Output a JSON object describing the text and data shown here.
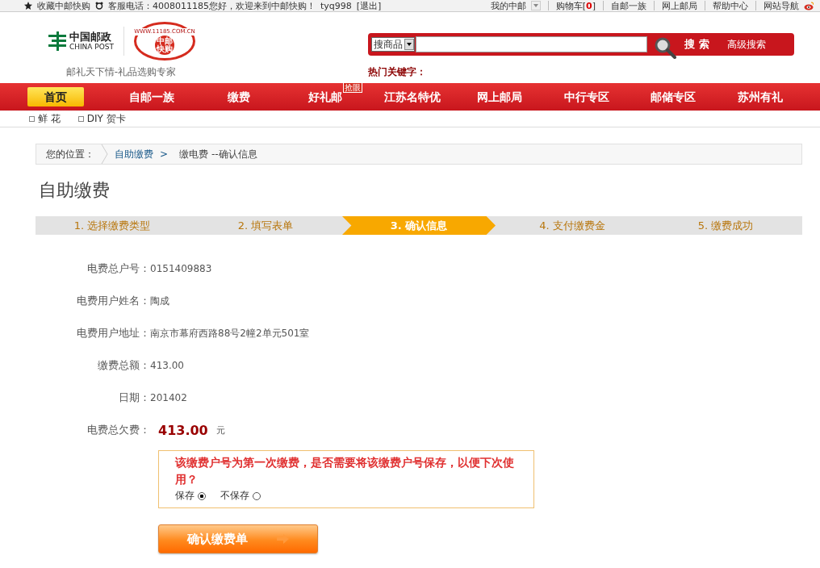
{
  "top_bar": {
    "favorite": "收藏中邮快购",
    "hotline": "客服电话：4008011185您好，欢迎来到中邮快购！",
    "user": "tyq998",
    "logout": "[退出]",
    "links": [
      {
        "label": "我的中邮",
        "kind": "dropdown"
      },
      {
        "label": "购物车[",
        "count": "0",
        "close": "]",
        "kind": "cart"
      },
      {
        "label": "自邮一族",
        "kind": "link"
      },
      {
        "label": "网上邮局",
        "kind": "link"
      },
      {
        "label": "帮助中心",
        "kind": "link"
      },
      {
        "label": "网站导航",
        "kind": "link"
      }
    ]
  },
  "header": {
    "logo_cn": "中国邮政",
    "logo_en": "CHINA POST",
    "badge_top": "WWW.11185.COM.CN",
    "badge_center": "中邮快购",
    "slogan": "邮礼天下情-礼品选购专家",
    "search_scope": "搜商品",
    "search_button": "搜 索",
    "advanced": "高级搜索",
    "hot_keywords": "热门关键字："
  },
  "nav": [
    {
      "label": "首页",
      "selected": true
    },
    {
      "label": "自邮一族",
      "selected": false
    },
    {
      "label": "缴费",
      "selected": false
    },
    {
      "label": "好礼邮",
      "selected": false,
      "badge": "抢眼"
    },
    {
      "label": "江苏名特优",
      "selected": false
    },
    {
      "label": "网上邮局",
      "selected": false
    },
    {
      "label": "中行专区",
      "selected": false
    },
    {
      "label": "邮储专区",
      "selected": false
    },
    {
      "label": "苏州有礼",
      "selected": false
    }
  ],
  "sub_nav": [
    "鲜 花",
    "DIY 贺卡"
  ],
  "breadcrumb": {
    "label": "您的位置：",
    "link": "自助缴费",
    "separator": ">",
    "current": "缴电费 --确认信息"
  },
  "page_title": "自助缴费",
  "steps": [
    {
      "label": "1. 选择缴费类型",
      "selected": false
    },
    {
      "label": "2. 填写表单",
      "selected": false
    },
    {
      "label": "3. 确认信息",
      "selected": true
    },
    {
      "label": "4. 支付缴费金",
      "selected": false
    },
    {
      "label": "5. 缴费成功",
      "selected": false
    }
  ],
  "fields": [
    {
      "label": "电费总户号：",
      "value": "0151409883",
      "kind": "plain"
    },
    {
      "label": "电费用户姓名：",
      "value": "陶成",
      "kind": "plain"
    },
    {
      "label": "电费用户地址：",
      "value": "南京市幕府西路88号2幢2单元501室",
      "kind": "plain"
    },
    {
      "label": "缴费总额：",
      "value": "413.00",
      "kind": "plain"
    },
    {
      "label": "日期：",
      "value": "201402",
      "kind": "plain"
    },
    {
      "label": "电费总欠费：",
      "value": "413.00",
      "unit": "元",
      "kind": "amount"
    }
  ],
  "save_prompt": {
    "question": "该缴费户号为第一次缴费，是否需要将该缴费户号保存，以便下次使用？",
    "options": [
      {
        "label": "保存",
        "selected": true
      },
      {
        "label": "不保存",
        "selected": false
      }
    ]
  },
  "confirm_button": "确认缴费单"
}
